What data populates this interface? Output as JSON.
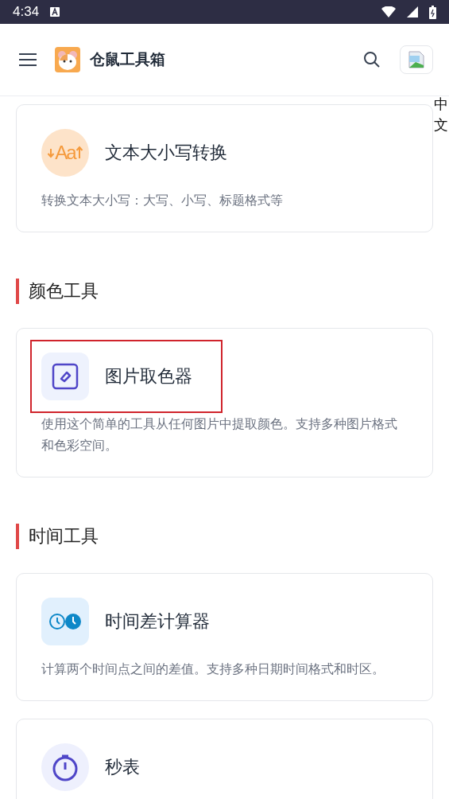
{
  "status_bar": {
    "time": "4:34"
  },
  "header": {
    "title": "仓鼠工具箱",
    "language": "中文"
  },
  "sections": [
    {
      "cards": [
        {
          "kind": "case",
          "glyph": "Aa",
          "title": "文本大小写转换",
          "description": "转换文本大小写：大写、小写、标题格式等",
          "highlighted": false
        }
      ]
    },
    {
      "heading": "颜色工具",
      "cards": [
        {
          "kind": "picker",
          "title": "图片取色器",
          "description": "使用这个简单的工具从任何图片中提取颜色。支持多种图片格式和色彩空间。",
          "highlighted": true
        }
      ]
    },
    {
      "heading": "时间工具",
      "cards": [
        {
          "kind": "clocks",
          "title": "时间差计算器",
          "description": "计算两个时间点之间的差值。支持多种日期时间格式和时区。",
          "highlighted": false
        },
        {
          "kind": "stopwatch",
          "title": "秒表",
          "highlighted": false
        }
      ]
    }
  ]
}
